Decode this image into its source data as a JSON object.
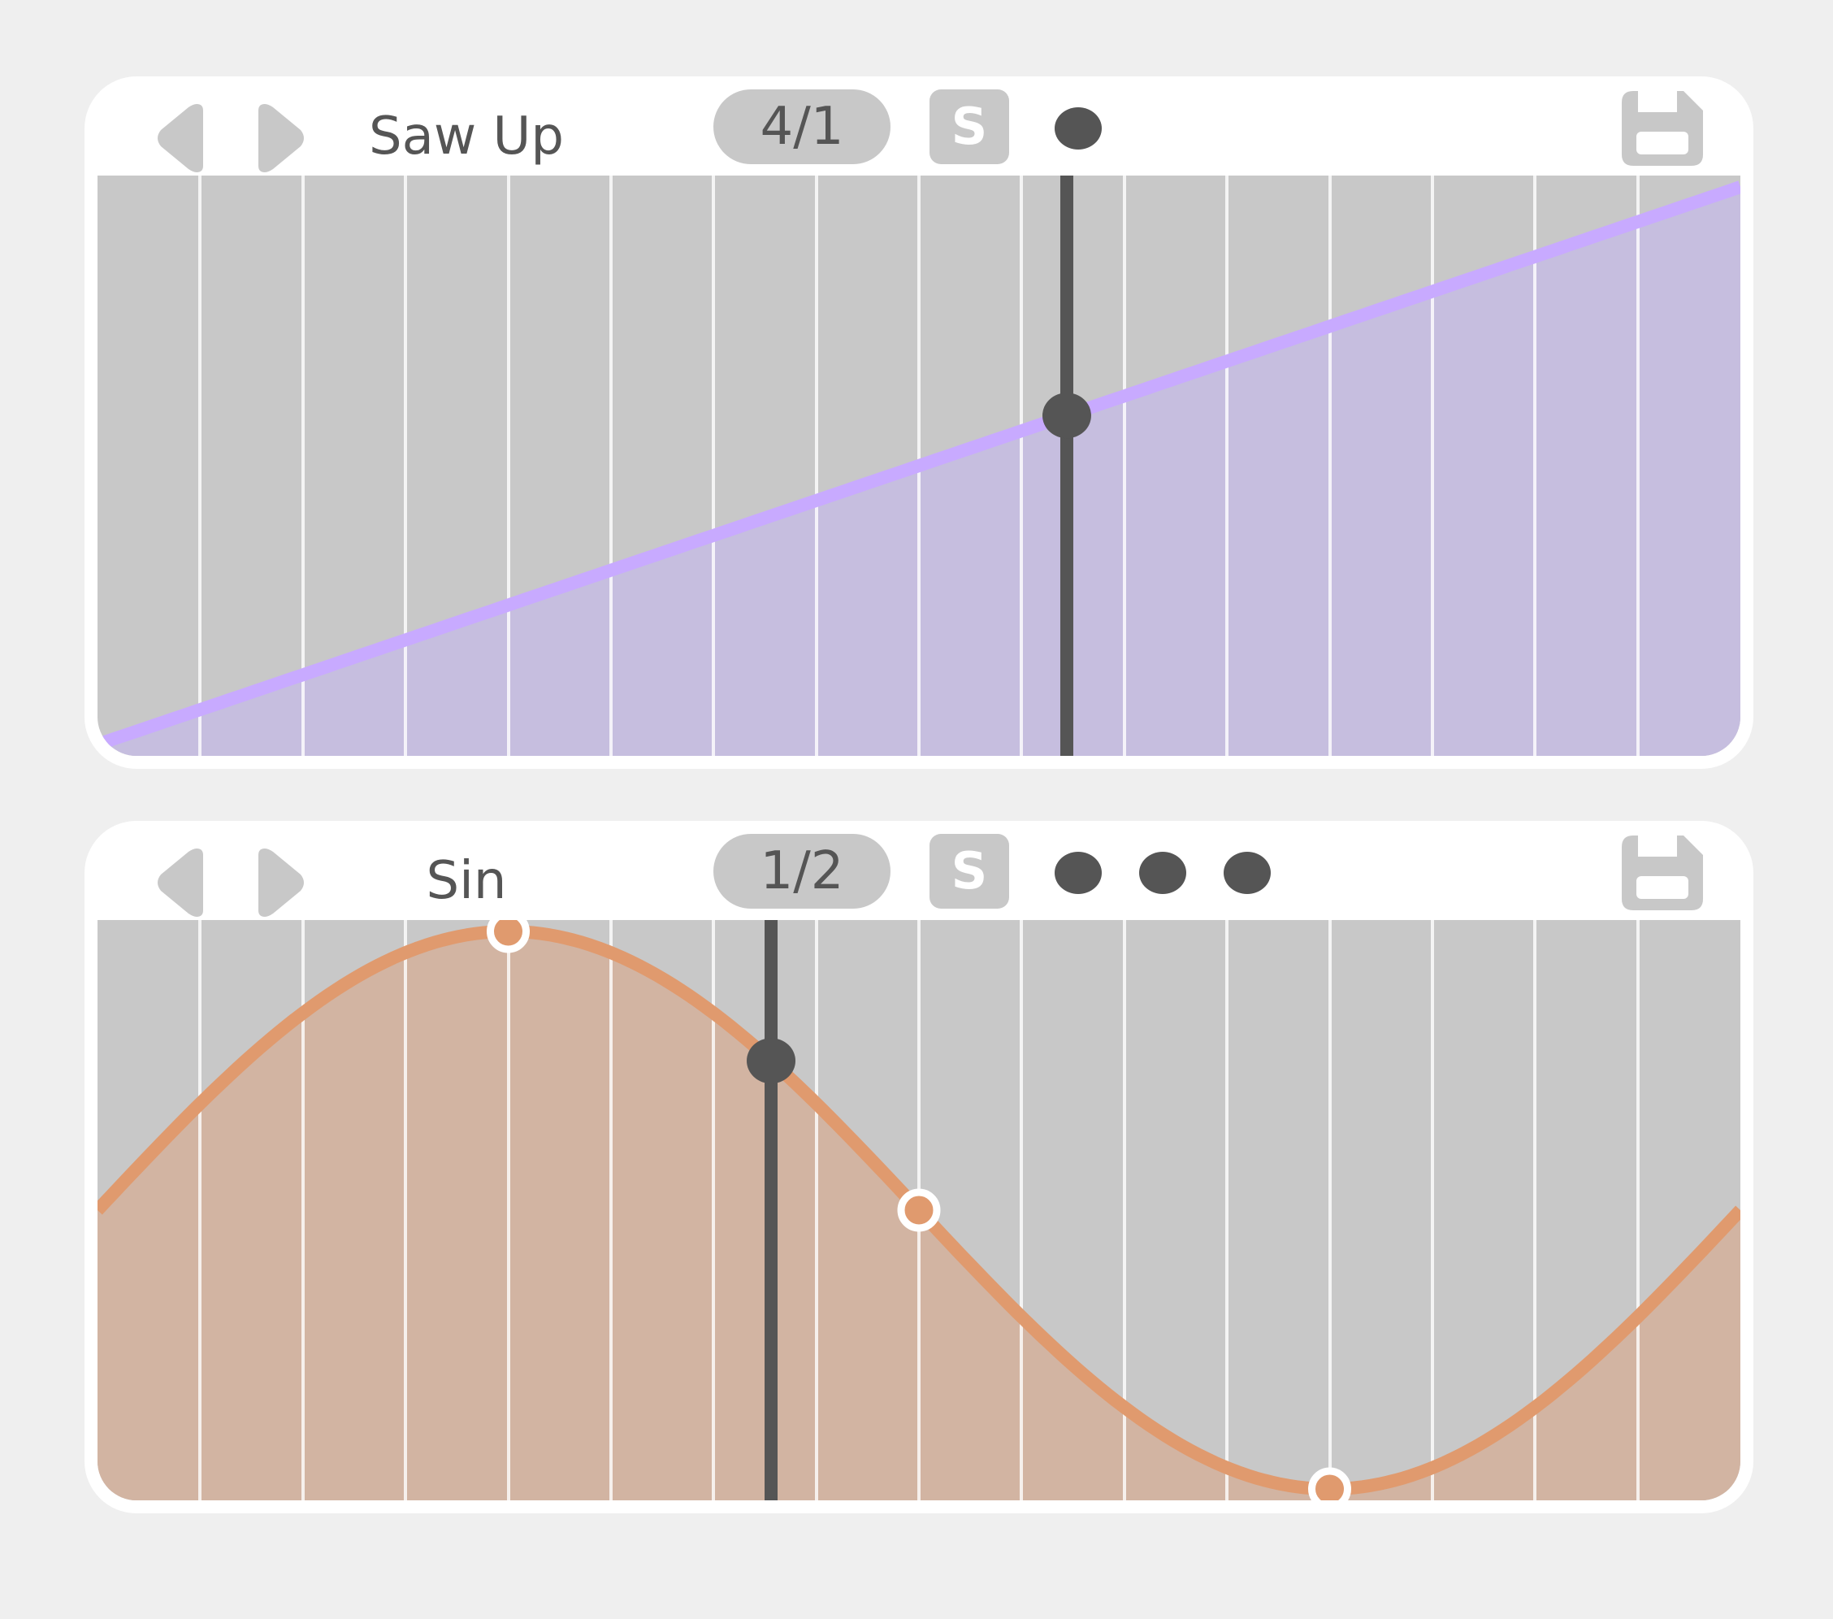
{
  "lfos": [
    {
      "name": "Saw Up",
      "rate": "4/1",
      "snap_label": "S",
      "dots": 1,
      "icons": [
        "triangle-left-icon",
        "triangle-right-icon",
        "floppy-disk-icon"
      ],
      "colors": {
        "curve": "#c8aaff",
        "fill": "#c6bedf",
        "grid_bg": "#c8c8c8",
        "playhead": "#555555"
      },
      "waveform": "saw-up",
      "playhead_phase": 0.59
    },
    {
      "name": "Sin",
      "rate": "1/2",
      "snap_label": "S",
      "dots": 3,
      "icons": [
        "triangle-left-icon",
        "triangle-right-icon",
        "floppy-disk-icon"
      ],
      "colors": {
        "curve": "#e09a6e",
        "fill": "#d2b4a2",
        "grid_bg": "#c8c8c8",
        "playhead": "#555555"
      },
      "waveform": "sine",
      "playhead_phase": 0.41,
      "control_points": [
        {
          "phase": 0.25,
          "value": 1.0
        },
        {
          "phase": 0.5,
          "value": 0.5
        },
        {
          "phase": 0.75,
          "value": 0.0
        }
      ]
    }
  ],
  "grid_divisions": 16
}
